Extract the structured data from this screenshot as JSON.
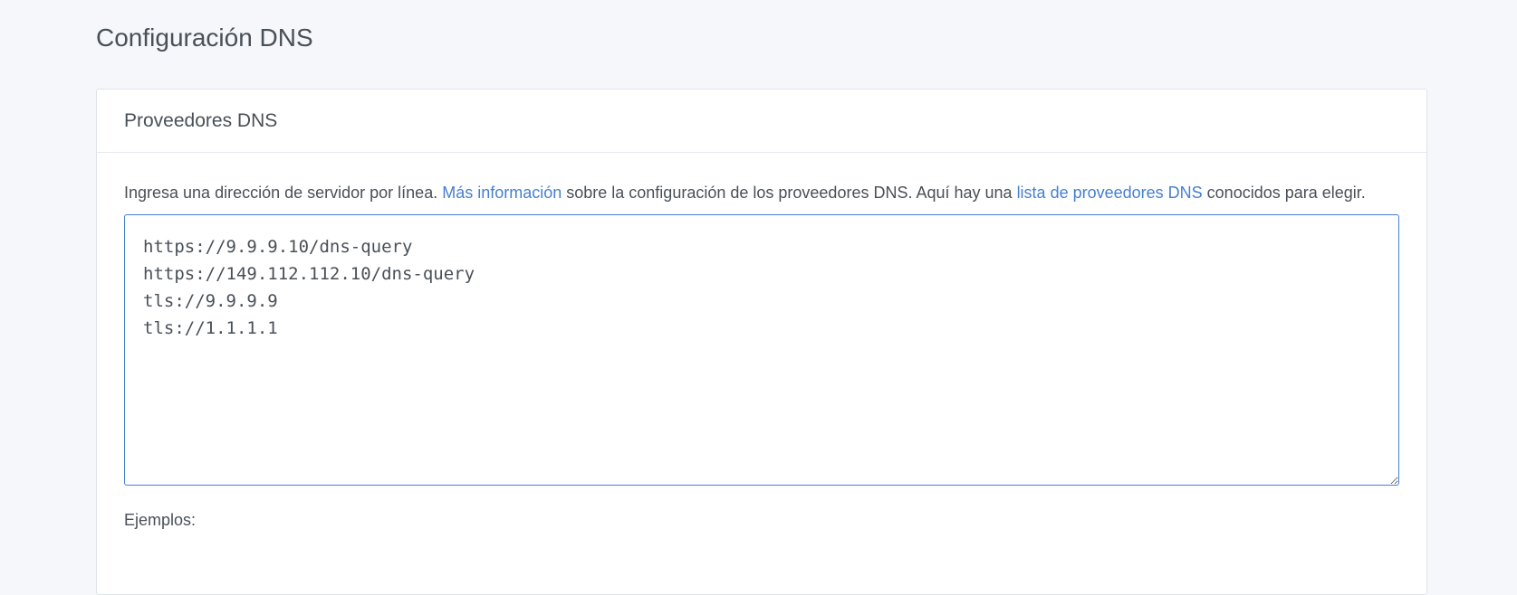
{
  "page": {
    "title": "Configuración DNS"
  },
  "card": {
    "title": "Proveedores DNS",
    "description": {
      "part1": "Ingresa una dirección de servidor por línea. ",
      "link1": "Más información",
      "part2": " sobre la configuración de los proveedores DNS. Aquí hay una ",
      "link2": "lista de proveedores DNS",
      "part3": " conocidos para elegir."
    },
    "upstreams_value": "https://9.9.9.10/dns-query\nhttps://149.112.112.10/dns-query\ntls://9.9.9.9\ntls://1.1.1.1",
    "examples_label": "Ejemplos:"
  },
  "colors": {
    "link": "#467fcf",
    "text": "#495057",
    "background": "#f5f7fb",
    "focus_border": "#467fcf"
  }
}
